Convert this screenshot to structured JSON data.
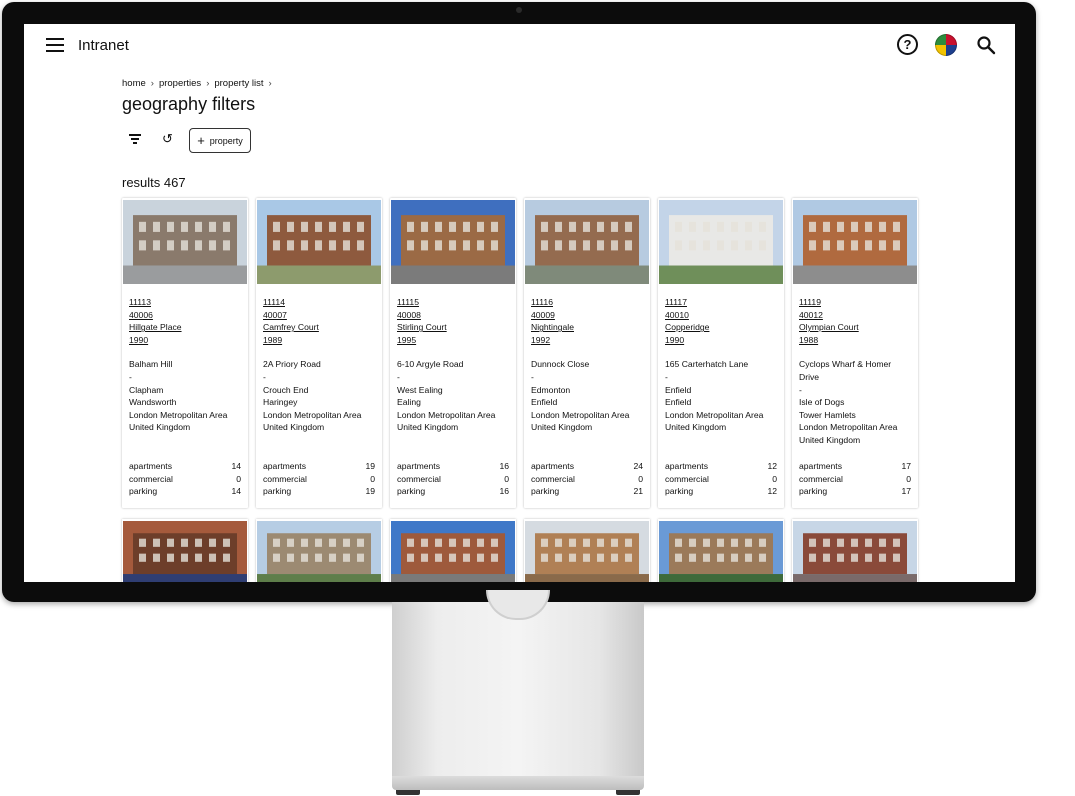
{
  "app": {
    "title": "Intranet"
  },
  "breadcrumb": [
    {
      "label": "home"
    },
    {
      "label": "properties"
    },
    {
      "label": "property list"
    }
  ],
  "breadcrumb_sep": "›",
  "page": {
    "title": "geography filters",
    "add_label": "property",
    "results_label": "results 467"
  },
  "colors": {
    "text": "#111111",
    "card_shadow": "#d0d0d0",
    "bezel": "#0c0c0c"
  },
  "properties": [
    {
      "id": "11113",
      "ref": "40006",
      "name": "Hillgate Place",
      "year": "1990",
      "address": [
        "Balham Hill",
        "-",
        "Clapham",
        "Wandsworth",
        "London Metropolitan Area",
        "United Kingdom"
      ],
      "apartments": "14",
      "commercial": "0",
      "parking": "14",
      "photo": {
        "sky": "#c9d3dc",
        "building": "#8a7a6c",
        "ground": "#9a9c9e"
      }
    },
    {
      "id": "11114",
      "ref": "40007",
      "name": "Camfrey Court",
      "year": "1989",
      "address": [
        "2A Priory Road",
        "-",
        "Crouch End",
        "Haringey",
        "London Metropolitan Area",
        "United Kingdom"
      ],
      "apartments": "19",
      "commercial": "0",
      "parking": "19",
      "photo": {
        "sky": "#a9c8e6",
        "building": "#8e5a3e",
        "ground": "#8d9b6d"
      }
    },
    {
      "id": "11115",
      "ref": "40008",
      "name": "Stirling Court",
      "year": "1995",
      "address": [
        "6-10 Argyle Road",
        "-",
        "West Ealing",
        "Ealing",
        "London Metropolitan Area",
        "United Kingdom"
      ],
      "apartments": "16",
      "commercial": "0",
      "parking": "16",
      "photo": {
        "sky": "#3f6fbf",
        "building": "#9b6a45",
        "ground": "#7b7b7b"
      }
    },
    {
      "id": "11116",
      "ref": "40009",
      "name": "Nightingale",
      "year": "1992",
      "address": [
        "Dunnock Close",
        "-",
        "Edmonton",
        "Enfield",
        "London Metropolitan Area",
        "United Kingdom"
      ],
      "apartments": "24",
      "commercial": "0",
      "parking": "21",
      "photo": {
        "sky": "#b7cbe0",
        "building": "#946b4f",
        "ground": "#7f8a7a"
      }
    },
    {
      "id": "11117",
      "ref": "40010",
      "name": "Copperidge",
      "year": "1990",
      "address": [
        "165 Carterhatch Lane",
        "-",
        "Enfield",
        "Enfield",
        "London Metropolitan Area",
        "United Kingdom"
      ],
      "apartments": "12",
      "commercial": "0",
      "parking": "12",
      "photo": {
        "sky": "#c3d4e8",
        "building": "#e8e8e6",
        "ground": "#6f8f5a"
      }
    },
    {
      "id": "11119",
      "ref": "40012",
      "name": "Olympian Court",
      "year": "1988",
      "address": [
        "Cyclops Wharf & Homer Drive",
        "-",
        "Isle of Dogs",
        "Tower Hamlets",
        "London Metropolitan Area",
        "United Kingdom"
      ],
      "apartments": "17",
      "commercial": "0",
      "parking": "17",
      "photo": {
        "sky": "#b0c9e3",
        "building": "#b06a3f",
        "ground": "#8d8d8d"
      }
    }
  ],
  "second_row_photos": [
    {
      "sky": "#a55a3c",
      "building": "#6d3e2a",
      "ground": "#2f3e73"
    },
    {
      "sky": "#b6cde4",
      "building": "#9c8a72",
      "ground": "#5e7e4a"
    },
    {
      "sky": "#3f78c8",
      "building": "#9e5a3c",
      "ground": "#7a7a7a"
    },
    {
      "sky": "#d5dbe1",
      "building": "#b08055",
      "ground": "#8a6a4a"
    },
    {
      "sky": "#6a9ad6",
      "building": "#9b7a5a",
      "ground": "#3e6a3a"
    },
    {
      "sky": "#c7d6e6",
      "building": "#8a4a3a",
      "ground": "#7a6a6a"
    }
  ],
  "labels": {
    "apartments": "apartments",
    "commercial": "commercial",
    "parking": "parking"
  }
}
